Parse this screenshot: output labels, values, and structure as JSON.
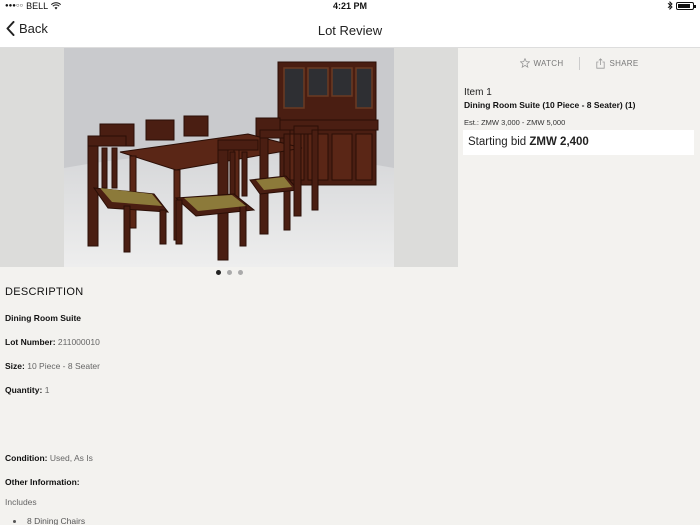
{
  "status_bar": {
    "carrier": "BELL",
    "time": "4:21 PM",
    "battery_level": 0.85
  },
  "nav": {
    "back_label": "Back",
    "title": "Lot Review"
  },
  "gallery": {
    "image_count": 3,
    "active_index": 0
  },
  "actions": {
    "watch_label": "WATCH",
    "share_label": "SHARE"
  },
  "lot": {
    "item_label": "Item 1",
    "title": "Dining Room Suite (10 Piece - 8 Seater) (1)",
    "estimate": "Est.: ZMW 3,000 - ZMW 5,000",
    "starting_bid_label": "Starting bid",
    "starting_bid_value": "ZMW 2,400"
  },
  "description": {
    "heading": "DESCRIPTION",
    "name": "Dining Room Suite",
    "lot_number_label": "Lot Number:",
    "lot_number": "211000010",
    "size_label": "Size:",
    "size": "10 Piece - 8 Seater",
    "quantity_label": "Quantity:",
    "quantity": "1",
    "condition_label": "Condition:",
    "condition": "Used, As Is",
    "other_info_label": "Other Information:",
    "includes": "Includes",
    "include_items": [
      "8 Dining Chairs"
    ]
  },
  "colors": {
    "background": "#f3f2ef",
    "wood": "#4a1e12"
  }
}
